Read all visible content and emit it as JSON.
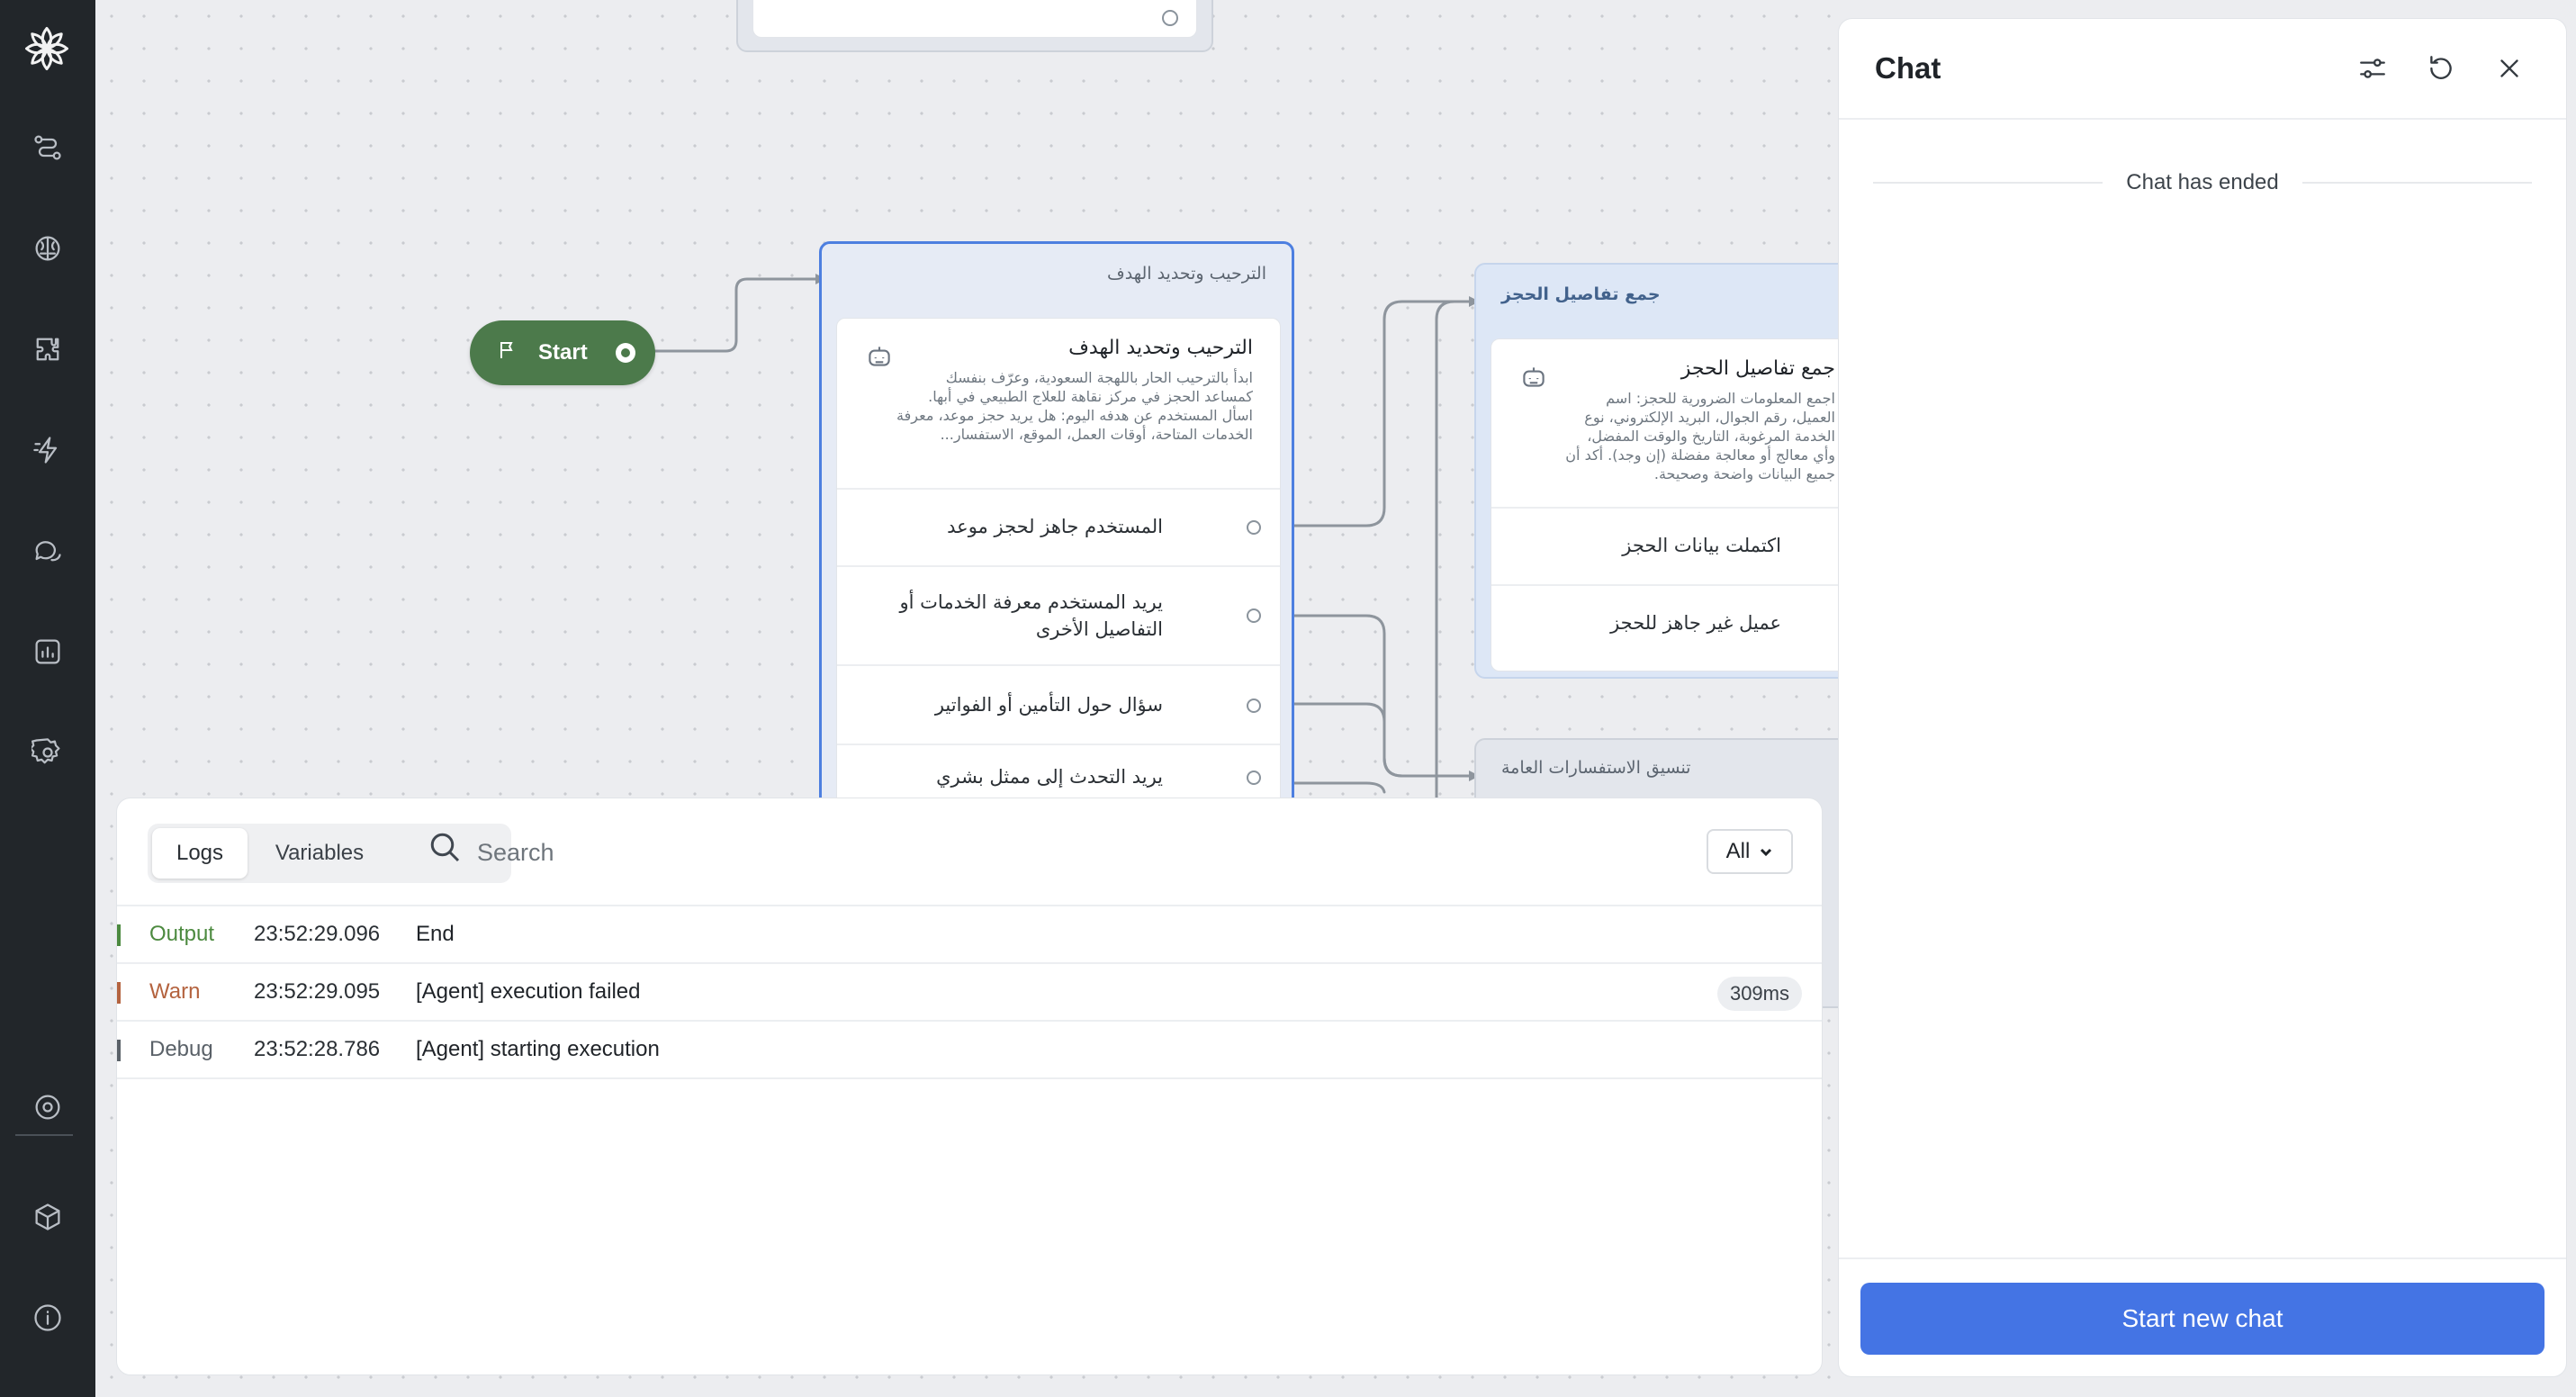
{
  "sidebar": {
    "items": [
      {
        "icon": "logo-icon"
      },
      {
        "icon": "flows-icon"
      },
      {
        "icon": "brain-icon"
      },
      {
        "icon": "puzzle-icon"
      },
      {
        "icon": "actions-icon"
      },
      {
        "icon": "conversations-icon"
      },
      {
        "icon": "analytics-icon"
      },
      {
        "icon": "settings-icon"
      },
      {
        "icon": "target-icon"
      },
      {
        "icon": "package-icon"
      },
      {
        "icon": "info-icon"
      }
    ]
  },
  "canvas": {
    "start_node": {
      "label": "Start"
    },
    "top_partial_node": {
      "label": "…"
    },
    "welcome_node": {
      "title": "الترحيب وتحديد الهدف",
      "card_title": "الترحيب وتحديد الهدف",
      "card_desc": "ابدأ بالترحيب الحار باللهجة السعودية، وعرّف بنفسك كمساعد الحجز في مركز نقاهة للعلاج الطبيعي في أبها. اسأل المستخدم عن هدفه اليوم: هل يريد حجز موعد، معرفة الخدمات المتاحة، أوقات العمل، الموقع، الاستفسار...",
      "outputs": [
        "المستخدم جاهز لحجز موعد",
        "يريد المستخدم معرفة الخدمات أو التفاصيل الأخرى",
        "سؤال حول التأمين أو الفواتير",
        "يريد التحدث إلى ممثل بشري"
      ]
    },
    "booking_node": {
      "title": "جمع تفاصيل الحجز",
      "card_title": "جمع تفاصيل الحجز",
      "card_desc": "اجمع المعلومات الضرورية للحجز: اسم العميل، رقم الجوال، البريد الإلكتروني، نوع الخدمة المرغوبة، التاريخ والوقت المفضل، وأي معالج أو معالجة مفضلة (إن وجد). أكد أن جميع البيانات واضحة وصحيحة.",
      "outputs": [
        "اكتملت بيانات الحجز",
        "عميل غير جاهز للحجز"
      ]
    },
    "general_node": {
      "title": "تنسيق الاستفسارات العامة"
    }
  },
  "logs": {
    "tabs": [
      {
        "label": "Logs",
        "active": true
      },
      {
        "label": "Variables",
        "active": false
      }
    ],
    "search_placeholder": "Search",
    "filter_value": "All",
    "rows": [
      {
        "level": "Output",
        "time": "23:52:29.096",
        "message": "End",
        "duration": "",
        "color": "#4c8a3f"
      },
      {
        "level": "Warn",
        "time": "23:52:29.095",
        "message": "[Agent] execution failed",
        "duration": "309ms",
        "color": "#b4633f"
      },
      {
        "level": "Debug",
        "time": "23:52:28.786",
        "message": "[Agent] starting execution",
        "duration": "",
        "color": "#5a6168"
      }
    ]
  },
  "chat": {
    "title": "Chat",
    "header_icons": [
      "sliders-icon",
      "reset-icon",
      "close-icon"
    ],
    "status": "Chat has ended",
    "new_chat_label": "Start new chat"
  },
  "colors": {
    "accent": "#4474e4",
    "start_node": "#4c7a4b",
    "selected_border": "#4d7fe0",
    "rail": "#22262a"
  }
}
